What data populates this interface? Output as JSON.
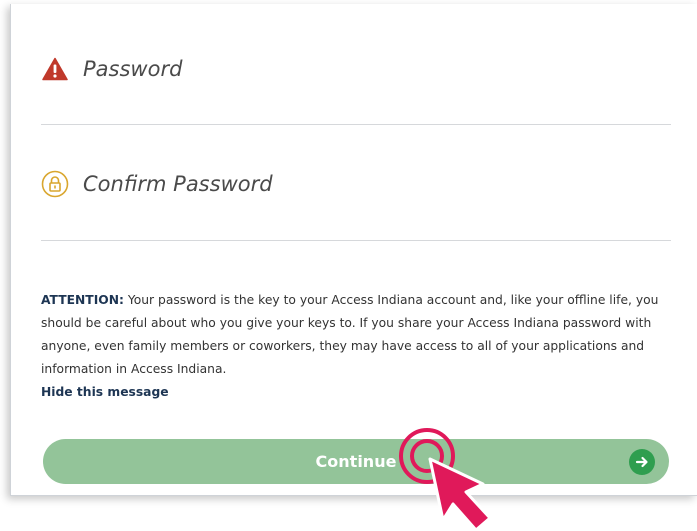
{
  "form": {
    "password": {
      "placeholder": "Password",
      "icon": "warning-icon"
    },
    "confirm_password": {
      "placeholder": "Confirm Password",
      "icon": "lock-icon"
    }
  },
  "attention": {
    "label": "ATTENTION:",
    "text": " Your password is the key to your Access Indiana account and, like your offline life, you should be careful about who you give your keys to. If you share your Access Indiana password with anyone, even family members or coworkers, they may have access to all of your applications and information in Access Indiana."
  },
  "hide_message": {
    "label": "Hide this message"
  },
  "continue": {
    "label": "Continue",
    "icon": "arrow-right-icon"
  },
  "colors": {
    "warning": "#c0392b",
    "lock": "#d9a62e",
    "button": "#93c499",
    "arrow": "#2f9e4f",
    "cursor": "#e0195a",
    "link": "#1d3553"
  }
}
